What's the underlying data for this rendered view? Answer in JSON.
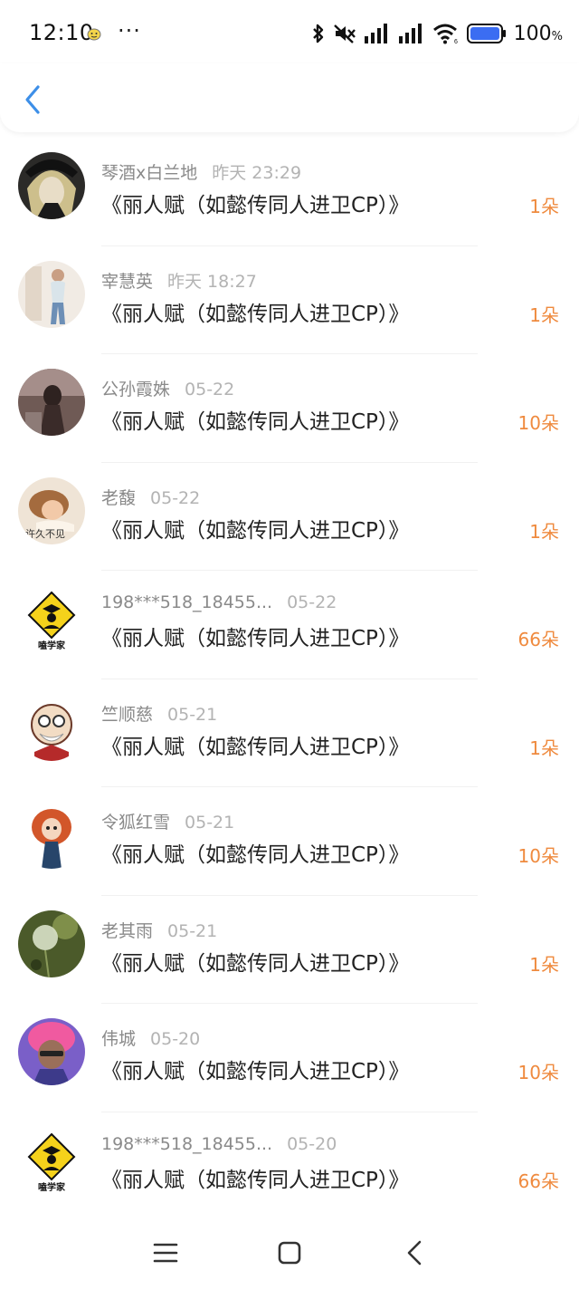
{
  "status_bar": {
    "time": "12:10",
    "dots": "···",
    "battery": "100",
    "battery_unit": "%"
  },
  "header": {
    "back_icon": "chevron-left-icon",
    "accent_color": "#3d8fe8"
  },
  "colors": {
    "amount": "#ef8a3e",
    "name": "#8a8a8a",
    "date": "#b3b3b3",
    "title": "#222222"
  },
  "gifts": [
    {
      "name": "琴酒x白兰地",
      "date": "昨天 23:29",
      "title": "《丽人赋（如懿传同人进卫CP）》",
      "amount": "1朵"
    },
    {
      "name": "宰慧英",
      "date": "昨天 18:27",
      "title": "《丽人赋（如懿传同人进卫CP）》",
      "amount": "1朵"
    },
    {
      "name": "公孙霞姝",
      "date": "05-22",
      "title": "《丽人赋（如懿传同人进卫CP）》",
      "amount": "10朵"
    },
    {
      "name": "老馥",
      "date": "05-22",
      "title": "《丽人赋（如懿传同人进卫CP）》",
      "amount": "1朵"
    },
    {
      "name": "198***518_18455...",
      "date": "05-22",
      "title": "《丽人赋（如懿传同人进卫CP）》",
      "amount": "66朵"
    },
    {
      "name": "竺顺慈",
      "date": "05-21",
      "title": "《丽人赋（如懿传同人进卫CP）》",
      "amount": "1朵"
    },
    {
      "name": "令狐红雪",
      "date": "05-21",
      "title": "《丽人赋（如懿传同人进卫CP）》",
      "amount": "10朵"
    },
    {
      "name": "老其雨",
      "date": "05-21",
      "title": "《丽人赋（如懿传同人进卫CP）》",
      "amount": "1朵"
    },
    {
      "name": "伟城",
      "date": "05-20",
      "title": "《丽人赋（如懿传同人进卫CP）》",
      "amount": "10朵"
    },
    {
      "name": "198***518_18455...",
      "date": "05-20",
      "title": "《丽人赋（如懿传同人进卫CP）》",
      "amount": "66朵"
    }
  ],
  "nav": {
    "menu_icon": "menu-icon",
    "home_icon": "home-square-icon",
    "back_icon": "back-triangle-icon"
  }
}
